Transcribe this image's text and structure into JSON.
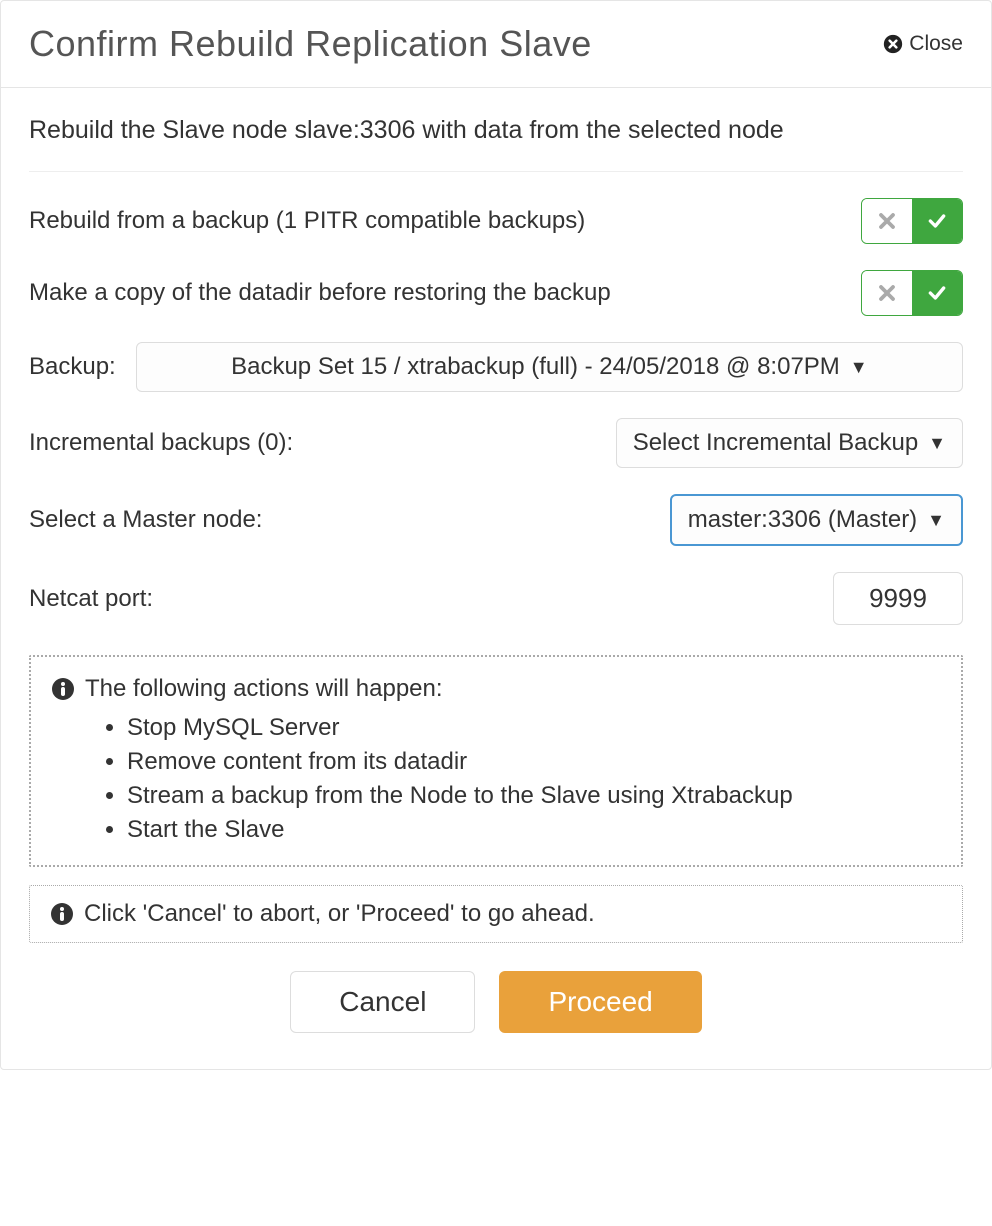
{
  "modal": {
    "title": "Confirm Rebuild Replication Slave",
    "close_label": "Close"
  },
  "intro": "Rebuild the Slave node slave:3306 with data from the selected node",
  "options": {
    "rebuild_from_backup_label": "Rebuild from a backup (1 PITR compatible backups)",
    "make_copy_label": "Make a copy of the datadir before restoring the backup"
  },
  "backup": {
    "label": "Backup:",
    "selected": "Backup Set 15 / xtrabackup (full) - 24/05/2018 @ 8:07PM"
  },
  "incremental": {
    "label": "Incremental backups (0):",
    "selected": "Select Incremental Backup"
  },
  "master": {
    "label": "Select a Master node:",
    "selected": "master:3306 (Master)"
  },
  "netcat": {
    "label": "Netcat port:",
    "value": "9999"
  },
  "actions": {
    "header": "The following actions will happen:",
    "items": [
      "Stop MySQL Server",
      "Remove content from its datadir",
      "Stream a backup from the Node to the Slave using Xtrabackup",
      "Start the Slave"
    ]
  },
  "hint": "Click 'Cancel' to abort, or 'Proceed' to go ahead.",
  "buttons": {
    "cancel": "Cancel",
    "proceed": "Proceed"
  }
}
